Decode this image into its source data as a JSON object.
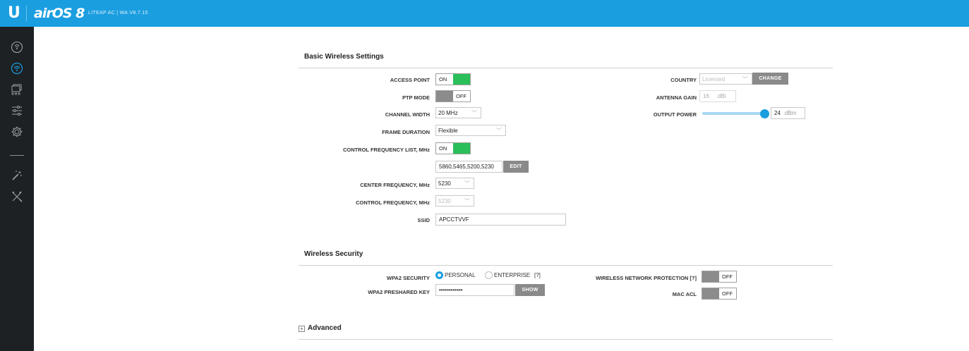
{
  "header": {
    "logo": "U",
    "product": "airOS 8",
    "device": "LITEAP AC | WA.V8.7.15"
  },
  "sidebar": {
    "items": [
      {
        "name": "dashboard-icon"
      },
      {
        "name": "wireless-icon",
        "active": true
      },
      {
        "name": "network-icon"
      },
      {
        "name": "services-icon"
      },
      {
        "name": "system-icon"
      },
      {
        "name": "wizard-icon"
      },
      {
        "name": "tools-icon"
      }
    ]
  },
  "basic": {
    "title": "Basic Wireless Settings",
    "access_point_label": "ACCESS POINT",
    "access_point_state": "ON",
    "ptp_mode_label": "PTP MODE",
    "ptp_mode_state": "OFF",
    "channel_width_label": "CHANNEL WIDTH",
    "channel_width_value": "20 MHz",
    "frame_duration_label": "FRAME DURATION",
    "frame_duration_value": "Flexible",
    "control_freq_list_label": "CONTROL FREQUENCY LIST, MHz",
    "control_freq_list_state": "ON",
    "control_freq_list_value": "5860,5465,5200,5230",
    "edit_label": "EDIT",
    "center_freq_label": "CENTER FREQUENCY, MHz",
    "center_freq_value": "5230",
    "control_freq_label": "CONTROL FREQUENCY, MHz",
    "control_freq_value": "5230",
    "ssid_label": "SSID",
    "ssid_value": "APCCTVVF",
    "country_label": "COUNTRY",
    "country_value": "Licensed",
    "change_label": "CHANGE",
    "antenna_gain_label": "ANTENNA GAIN",
    "antenna_gain_value": "16",
    "antenna_gain_unit": "dBi",
    "output_power_label": "OUTPUT POWER",
    "output_power_value": "24",
    "output_power_unit": "dBm",
    "output_power_level": 1.0
  },
  "security": {
    "title": "Wireless Security",
    "wpa2_label": "WPA2 SECURITY",
    "personal_label": "PERSONAL",
    "enterprise_label": "ENTERPRISE",
    "help_marker": "[?]",
    "selected": "PERSONAL",
    "key_label": "WPA2 PRESHARED KEY",
    "key_value": "••••••••••••",
    "show_label": "SHOW",
    "wnp_label": "WIRELESS NETWORK PROTECTION [?]",
    "wnp_state": "OFF",
    "mac_acl_label": "MAC ACL",
    "mac_acl_state": "OFF"
  },
  "advanced": {
    "label": "Advanced",
    "expand_symbol": "+"
  },
  "colors": {
    "topbar": "#1a9ee0",
    "sidebar": "#1e2124",
    "toggle_on": "#2bbf5a",
    "toggle_off": "#8c8c8c",
    "button": "#8a8a8a",
    "accent": "#1a9ee0"
  }
}
